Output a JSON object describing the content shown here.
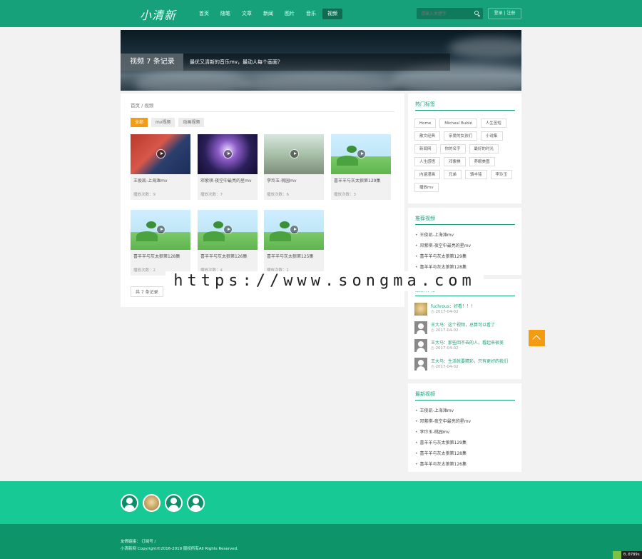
{
  "header": {
    "logo": "小清新",
    "nav": [
      "首页",
      "随笔",
      "文章",
      "新闻",
      "图片",
      "音乐",
      "视频"
    ],
    "active_nav": 6,
    "search_placeholder": "请输入关键字",
    "auth": "登录 | 注册"
  },
  "banner": {
    "tag": "视频 7 条记录",
    "desc": "最优又清新的音乐mv，最动人每个画面？"
  },
  "main": {
    "breadcrumb": "首页 / 视频",
    "filters": [
      "全部",
      "mv视频",
      "动画视频"
    ],
    "videos": [
      {
        "title": "王俊凯-上海滩mv",
        "plays": "播放次数：9"
      },
      {
        "title": "邓紫棋-夜空中最亮的星mv",
        "plays": "播放次数：7"
      },
      {
        "title": "李玲玉-桃园mv",
        "plays": "播放次数：6"
      },
      {
        "title": "喜羊羊与灰太狼第129集",
        "plays": "播放次数：3"
      },
      {
        "title": "喜羊羊与灰太狼第128集",
        "plays": "播放次数：2"
      },
      {
        "title": "喜羊羊与灰太狼第126集",
        "plays": "播放次数：4"
      },
      {
        "title": "喜羊羊与灰太狼第125集",
        "plays": "播放次数：1"
      }
    ],
    "pager": "共 7 条记录"
  },
  "sidebar": {
    "tags_title": "热门标签",
    "tags": [
      "Home",
      "Micheal Bublé",
      "人生苦短",
      "散文经典",
      "亲爱的女孩们",
      "小说集",
      "新闻网",
      "你的名字",
      "最好的时光",
      "人生感悟",
      "邓紫棋",
      "养眼美图",
      "内涵漫画",
      "兄弟",
      "骆丰铭",
      "李玲玉",
      "播放mv"
    ],
    "recommend_title": "推荐视频",
    "recommend": [
      "王俊凯-上海滩mv",
      "邓紫棋-夜空中最亮的星mv",
      "喜羊羊与灰太狼第129集",
      "喜羊羊与灰太狼第128集"
    ],
    "comments_title": "最新评论",
    "comments": [
      {
        "text": "fuchrous：好看！！！",
        "date": "2017-04-02"
      },
      {
        "text": "王大马：这个视频，总算可以看了",
        "date": "2017-04-02"
      },
      {
        "text": "王大马：那些回不去的人，看起来很美",
        "date": "2017-04-02"
      },
      {
        "text": "王大马：生活就要精彩，只有更好的我们",
        "date": "2017-04-02"
      }
    ],
    "latest_title": "最新视频",
    "latest": [
      "王俊凯-上海滩mv",
      "邓紫棋-夜空中最亮的星mv",
      "李玲玉-桃园mv",
      "喜羊羊与灰太狼第129集",
      "喜羊羊与灰太狼第128集",
      "喜羊羊与灰太狼第126集"
    ]
  },
  "watermark": "https://www.songma.com",
  "footer": {
    "line1": "友情链接：  订阅号   /",
    "line2": "小清新网 Copyright©2016-2019 版权所有All Rights Reserved.",
    "timer": "0.0789s"
  }
}
